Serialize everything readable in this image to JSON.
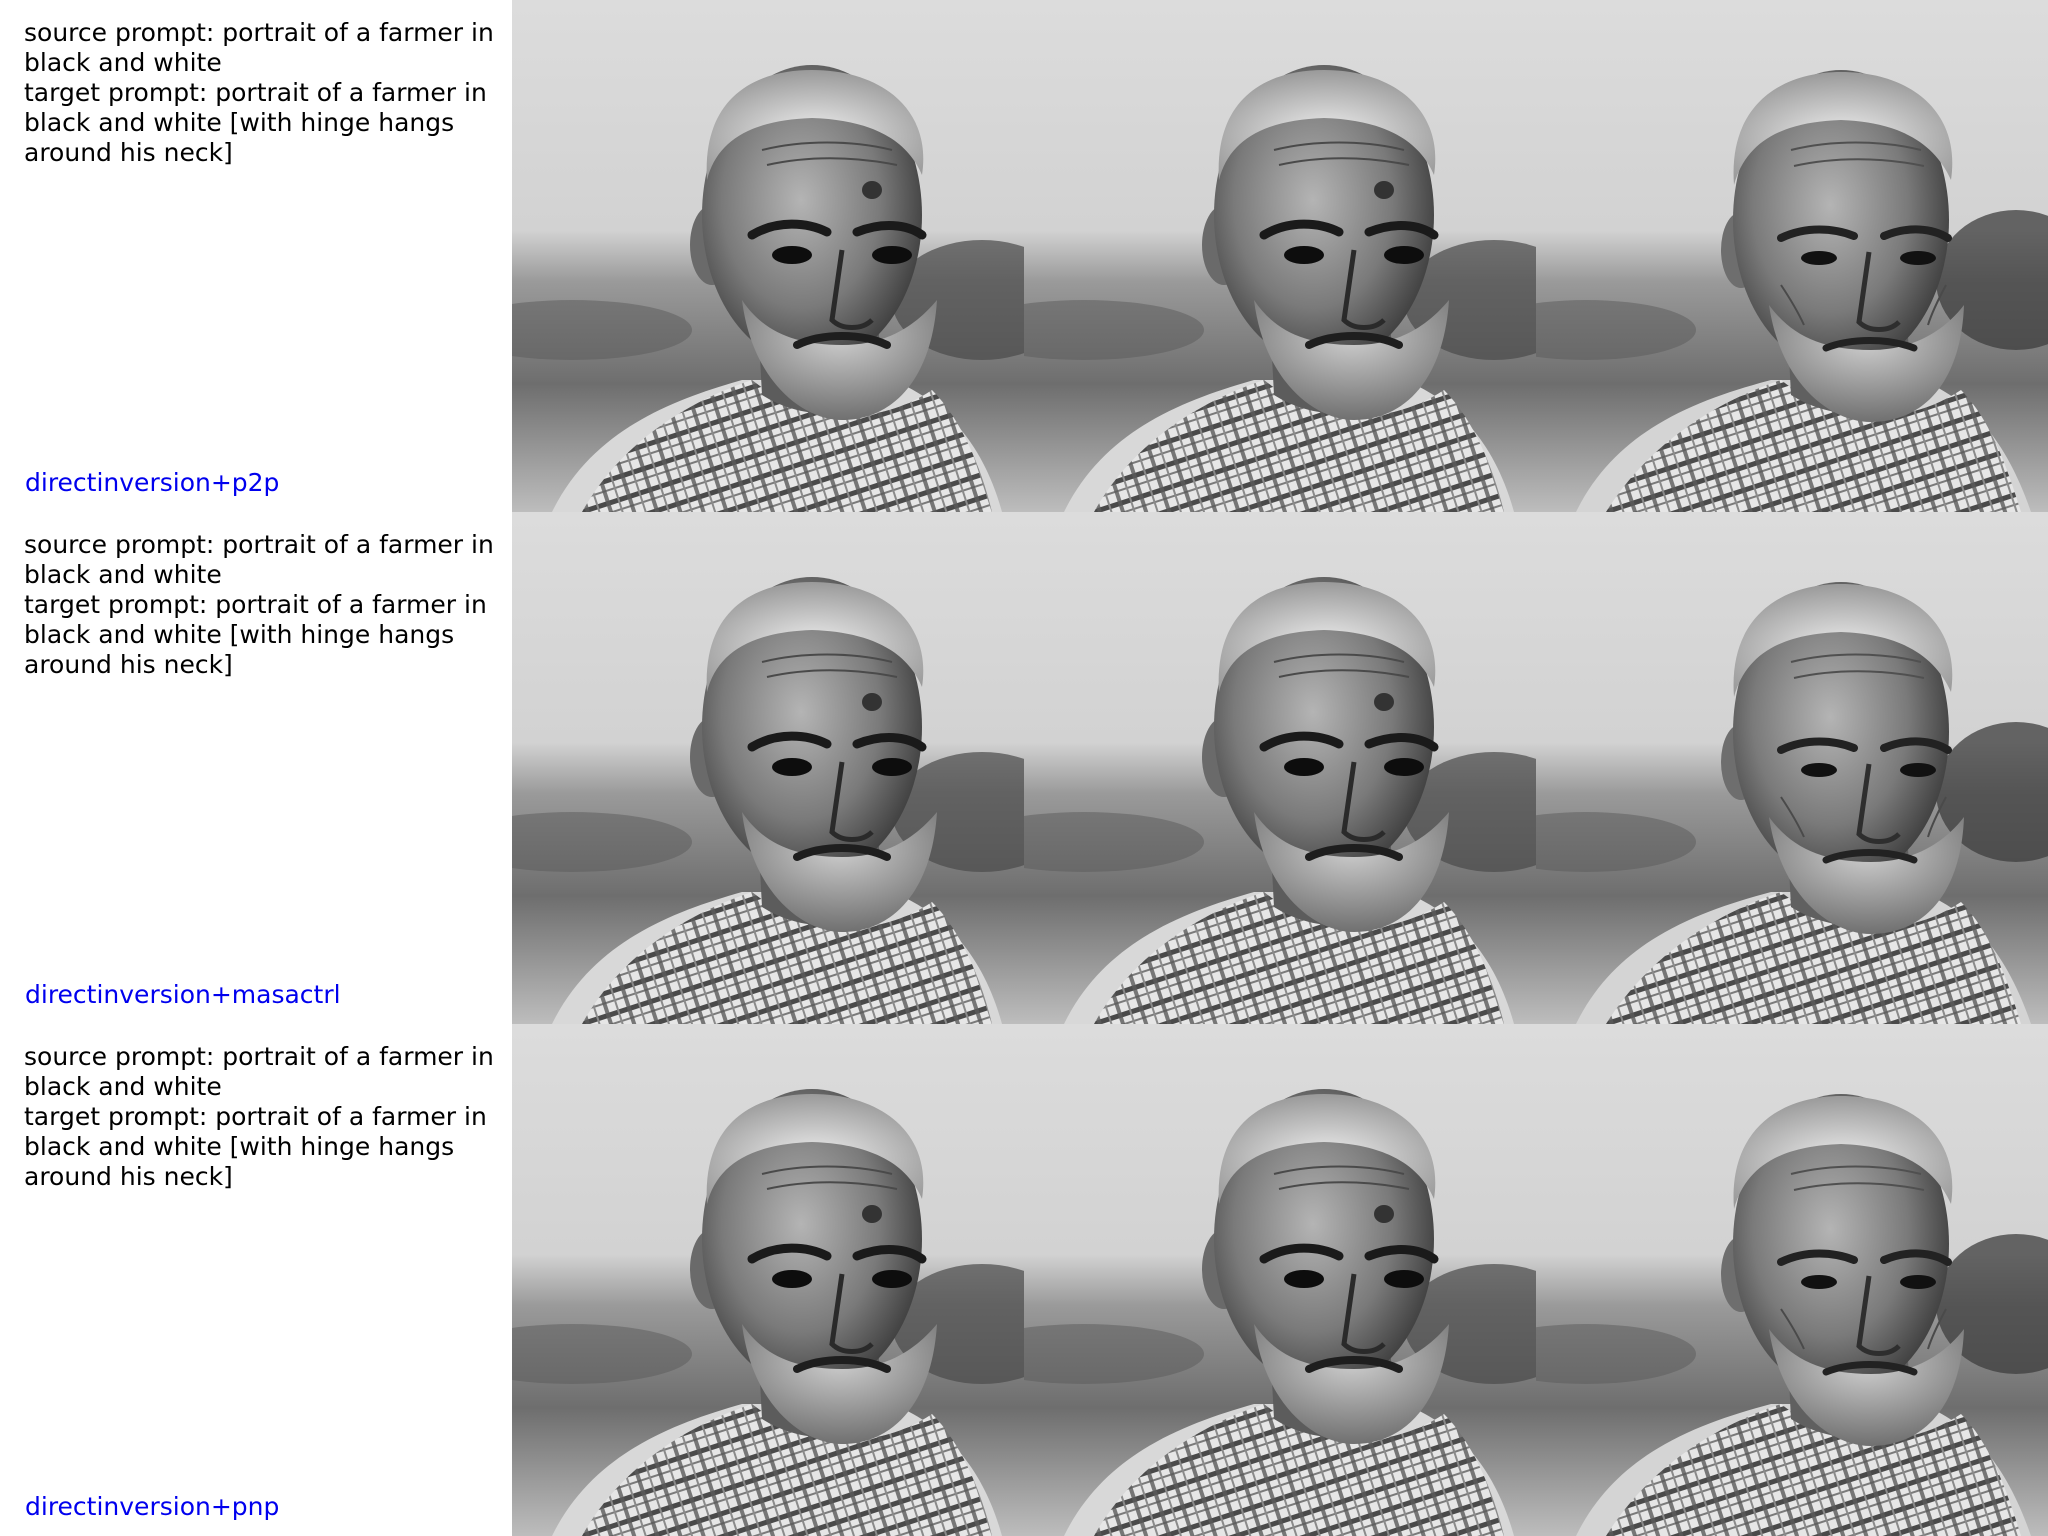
{
  "rows": [
    {
      "prompt_text": "source prompt: portrait of a farmer in\nblack and white\ntarget prompt: portrait of a farmer in\nblack and white [with hinge hangs\naround his neck]",
      "method": "directinversion+p2p"
    },
    {
      "prompt_text": "source prompt: portrait of a farmer in\nblack and white\ntarget prompt: portrait of a farmer in\nblack and white [with hinge hangs\naround his neck]",
      "method": "directinversion+masactrl"
    },
    {
      "prompt_text": "source prompt: portrait of a farmer in\nblack and white\ntarget prompt: portrait of a farmer in\nblack and white [with hinge hangs\naround his neck]",
      "method": "directinversion+pnp"
    }
  ],
  "colors": {
    "method_label": "#0000ee",
    "prompt_text": "#000000"
  }
}
